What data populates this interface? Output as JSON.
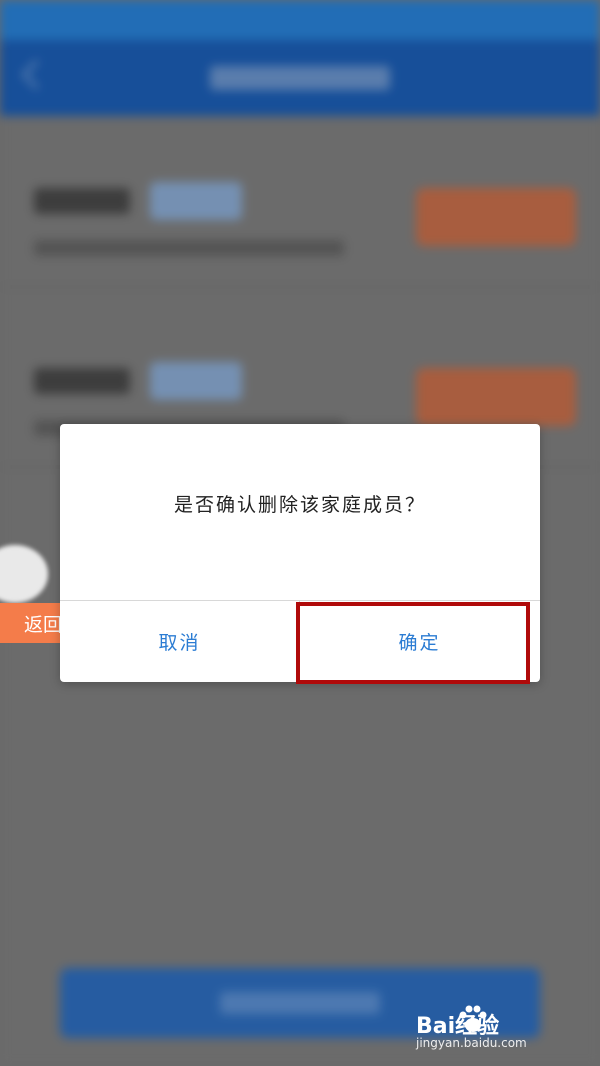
{
  "dialog": {
    "message": "是否确认删除该家庭成员？",
    "cancel_label": "取消",
    "confirm_label": "确定"
  },
  "floating": {
    "back_label": "返回"
  },
  "watermark": {
    "brand": "Bai经验",
    "site": "jingyan.baidu.com"
  },
  "colors": {
    "accent": "#2b7cd3",
    "highlight": "#b00a0a",
    "float_button": "#f47c4a",
    "topbar": "#0d4fa6"
  }
}
